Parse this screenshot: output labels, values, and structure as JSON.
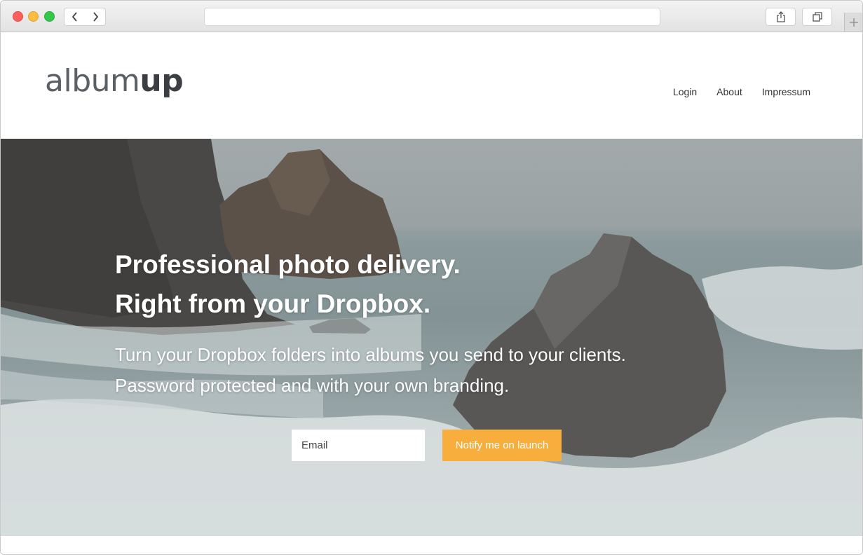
{
  "browser": {
    "url": "",
    "back_icon": "chevron-left-icon",
    "forward_icon": "chevron-right-icon",
    "share_icon": "share-icon",
    "tabs_icon": "tabs-overview-icon",
    "new_tab_icon": "plus-icon"
  },
  "brand": {
    "light": "album",
    "bold": "up"
  },
  "nav": {
    "items": [
      "Login",
      "About",
      "Impressum"
    ]
  },
  "hero": {
    "headline_line1": "Professional photo delivery.",
    "headline_line2": "Right from your Dropbox.",
    "subline_line1": "Turn your Dropbox folders into albums you send to your clients.",
    "subline_line2": "Password protected and with your own branding."
  },
  "signup": {
    "email_placeholder": "Email",
    "button_label": "Notify me on launch"
  },
  "colors": {
    "accent": "#f7ae3c",
    "logo": "#5b6066"
  }
}
